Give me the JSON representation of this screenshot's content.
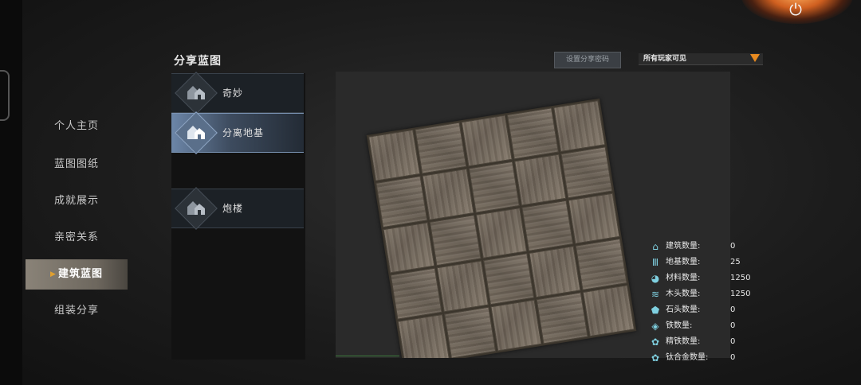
{
  "header": {
    "title": "分享蓝图",
    "share_code_label": "设置分享密码",
    "visibility": "所有玩家可见"
  },
  "nav": [
    {
      "label": "个人主页"
    },
    {
      "label": "蓝图图纸"
    },
    {
      "label": "成就展示"
    },
    {
      "label": "亲密关系"
    },
    {
      "label": "建筑蓝图",
      "active": true
    },
    {
      "label": "组装分享"
    }
  ],
  "blueprints": [
    {
      "label": "奇妙",
      "selected": false
    },
    {
      "label": "分离地基",
      "selected": true
    },
    {
      "label": "炮楼",
      "selected": false
    }
  ],
  "stats": [
    {
      "icon": "building-icon",
      "label": "建筑数量:",
      "value": "0"
    },
    {
      "icon": "foundation-icon",
      "label": "地基数量:",
      "value": "25"
    },
    {
      "icon": "material-icon",
      "label": "材料数量:",
      "value": "1250"
    },
    {
      "icon": "wood-icon",
      "label": "木头数量:",
      "value": "1250"
    },
    {
      "icon": "stone-icon",
      "label": "石头数量:",
      "value": "0"
    },
    {
      "icon": "iron-icon",
      "label": "铁数量:",
      "value": "0"
    },
    {
      "icon": "refined-iron-icon",
      "label": "精铁数量:",
      "value": "0"
    },
    {
      "icon": "titanium-icon",
      "label": "钛合金数量:",
      "value": "0"
    }
  ],
  "accent": "#e88a20"
}
